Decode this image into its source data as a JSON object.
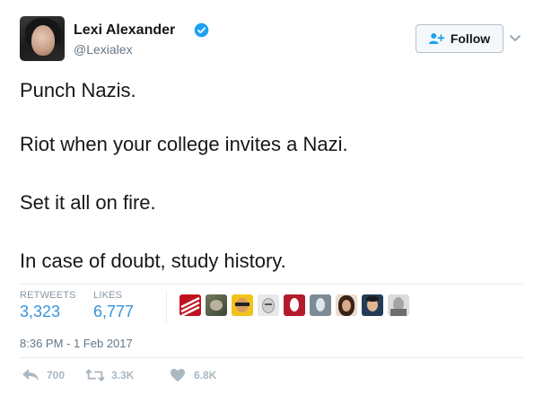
{
  "author": {
    "name": "Lexi Alexander",
    "handle": "@Lexialex",
    "verified": true
  },
  "follow_button": {
    "label": "Follow"
  },
  "tweet": {
    "lines": [
      "Punch Nazis.",
      "Riot when your college invites a Nazi.",
      "Set it all on fire.",
      "In case of doubt, study history."
    ],
    "timestamp": "8:36 PM - 1 Feb 2017"
  },
  "stats": {
    "retweets_label": "RETWEETS",
    "retweets_value": "3,323",
    "likes_label": "LIKES",
    "likes_value": "6,777"
  },
  "actions": {
    "reply_count": "700",
    "retweet_count": "3.3K",
    "like_count": "6.8K"
  },
  "colors": {
    "link_blue": "#3b94d9",
    "verified_blue": "#1da1f2",
    "muted_gray": "#657786",
    "action_gray": "#aab8c2"
  },
  "icons": {
    "verified": "verified-badge-icon",
    "follow": "person-add-icon",
    "caret": "chevron-down-icon",
    "reply": "reply-icon",
    "retweet": "retweet-icon",
    "like": "heart-icon"
  }
}
